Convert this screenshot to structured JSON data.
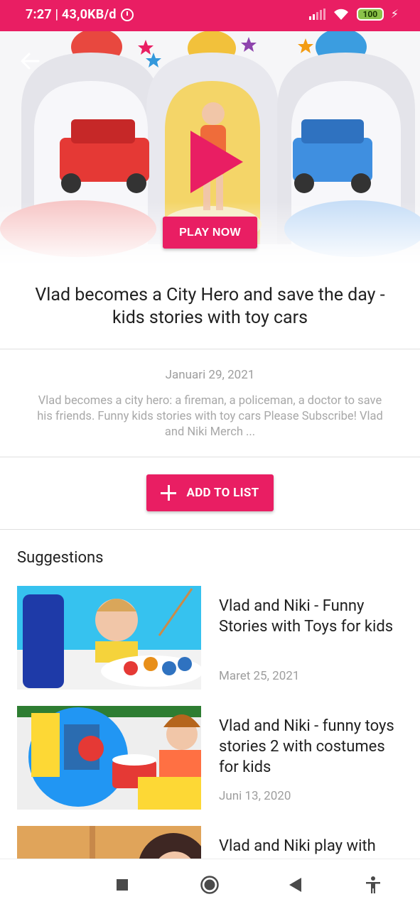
{
  "status_bar": {
    "time_speed": "7:27 | 43,0KB/d",
    "battery": "100",
    "icons": [
      "alarm-icon",
      "signal-icon",
      "wifi-icon",
      "battery-icon",
      "charging-icon"
    ]
  },
  "hero": {
    "back_icon": "arrow-left-icon",
    "play_icon": "play-triangle-icon",
    "play_label": "PLAY NOW"
  },
  "video": {
    "title": "Vlad becomes a City Hero and save the day - kids stories with toy cars",
    "date": "Januari 29, 2021",
    "description": "Vlad becomes a city hero: a fireman, a policeman, a doctor to save his friends. Funny kids stories with toy cars Please Subscribe! Vlad and Niki Merch ..."
  },
  "actions": {
    "add_to_list_label": "ADD TO LIST"
  },
  "suggestions": {
    "heading": "Suggestions",
    "items": [
      {
        "title": "Vlad and Niki - Funny Stories with Toys for kids",
        "date": "Maret 25, 2021"
      },
      {
        "title": "Vlad and Niki - funny toys stories 2 with costumes for kids",
        "date": "Juni 13, 2020"
      },
      {
        "title": "Vlad and Niki play with",
        "date": ""
      }
    ]
  },
  "nav_bar": {
    "icons": [
      "recents-square-icon",
      "home-circle-icon",
      "back-triangle-icon",
      "accessibility-icon"
    ]
  },
  "colors": {
    "accent": "#e91e63",
    "text_primary": "#212121",
    "text_secondary": "#9e9e9e"
  }
}
